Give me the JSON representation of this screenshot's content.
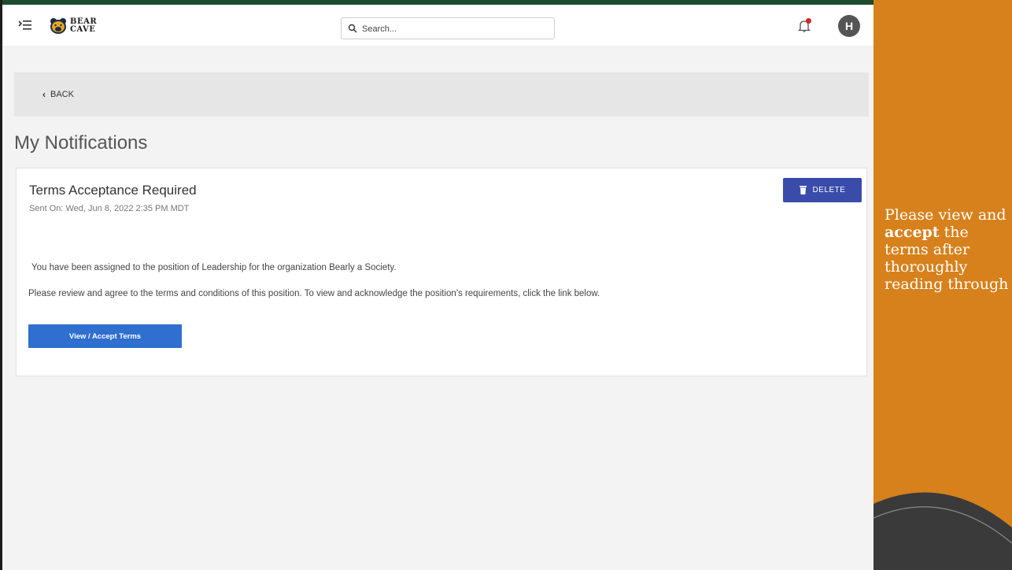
{
  "header": {
    "logo": {
      "line1": "BEAR",
      "line2": "CAVE"
    },
    "search": {
      "placeholder": "Search..."
    },
    "avatar_initial": "H"
  },
  "back": {
    "label": "BACK"
  },
  "page_title": "My Notifications",
  "notification": {
    "title": "Terms Acceptance Required",
    "sent_on": "Sent On: Wed, Jun 8, 2022 2:35 PM MDT",
    "delete_label": "DELETE",
    "message_1": "You have been assigned to the position of Leadership for the organization Bearly a Society.",
    "message_2": "Please review and agree to the terms and conditions of this position. To view and acknowledge the position's requirements, click the link below.",
    "action_label": "View / Accept Terms"
  },
  "side_panel": {
    "text_before": "Please view and ",
    "text_bold": "accept",
    "text_after": " the terms after thoroughly reading through"
  },
  "colors": {
    "accent_blue": "#2f6fcf",
    "delete_blue": "#3a4ca9",
    "side_orange": "#d7811c",
    "top_border_green": "#1e4a2e"
  }
}
